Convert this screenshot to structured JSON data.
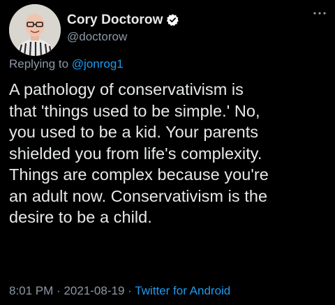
{
  "author": {
    "display_name": "Cory Doctorow",
    "handle": "@doctorow",
    "verified_icon": "verified-badge-icon",
    "avatar_icon": "profile-photo"
  },
  "reply": {
    "prefix": "Replying to",
    "mention": "@jonrog1"
  },
  "tweet": {
    "lines": [
      "A pathology of conservativism is",
      "that 'things used to be simple.' No,",
      "you used to be a kid. Your parents",
      "shielded you from life's complexity.",
      "Things are complex because you're",
      "an adult now. Conservativism is the",
      "desire to be a child."
    ]
  },
  "meta": {
    "time": "8:01 PM",
    "date": "2021-08-19",
    "separator": "·",
    "source": "Twitter for Android"
  },
  "colors": {
    "background": "#000000",
    "text": "#e7e9ea",
    "muted": "#8b98a5",
    "link": "#1d9bf0"
  }
}
